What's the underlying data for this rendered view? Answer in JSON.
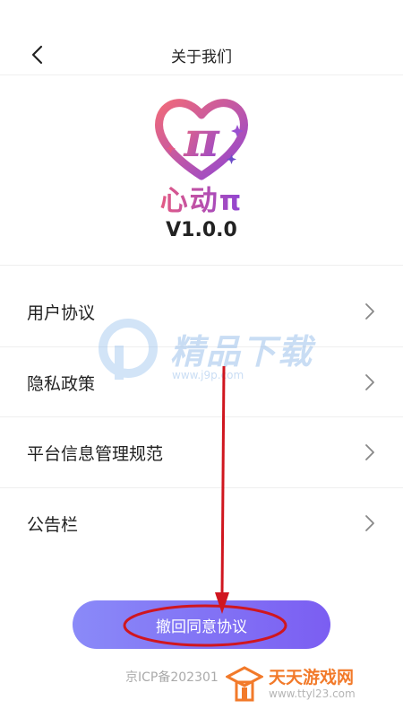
{
  "header": {
    "title": "关于我们",
    "back_icon": "chevron-left-icon"
  },
  "app": {
    "name": "心动π",
    "logo_glyph": "π",
    "version": "V1.0.0"
  },
  "menu": {
    "items": [
      {
        "label": "用户协议"
      },
      {
        "label": "隐私政策"
      },
      {
        "label": "平台信息管理规范"
      },
      {
        "label": "公告栏"
      }
    ],
    "chevron_icon": "chevron-right-icon"
  },
  "actions": {
    "revoke_label": "撤回同意协议"
  },
  "footer": {
    "icp": "京ICP备202301"
  },
  "watermarks": {
    "center_title": "精品下载",
    "center_url": "www.j9p.com",
    "corner_title": "天天游戏网",
    "corner_url": "www.ttyl23.com"
  },
  "colors": {
    "accent_start": "#8a8af8",
    "accent_end": "#7b5ef2",
    "annotation_red": "#d0161f",
    "logo_pink": "#e35a84",
    "logo_purple": "#8f45d4"
  }
}
